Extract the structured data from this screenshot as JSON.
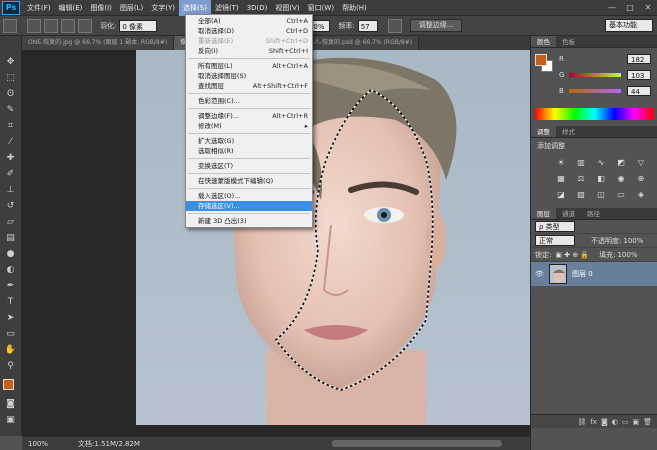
{
  "menubar": {
    "logo": "Ps",
    "items": [
      "文件(F)",
      "编辑(E)",
      "图像(I)",
      "图层(L)",
      "文字(Y)",
      "选择(S)",
      "滤镜(T)",
      "3D(D)",
      "视图(V)",
      "窗口(W)",
      "帮助(H)"
    ],
    "active_index": 5,
    "window_controls": [
      "—",
      "□",
      "✕"
    ]
  },
  "options": {
    "feather_label": "羽化:",
    "feather_value": "0 像素",
    "zoom_value": "0%",
    "frequency_label": "频率:",
    "frequency_value": "57",
    "refine_edge_button": "调整边缘...",
    "workspace": "基本功能"
  },
  "tabs": [
    {
      "label": "ONE-恢复的.jpg @ 66.7% (图层 1 副本, RGB/8#)",
      "active": false
    },
    {
      "label": "恢复的.jpg @ 66.7% (图层 0, RGB/8#) *",
      "active": true
    },
    {
      "label": "男人-恢复的.psd @ 66.7% (RGB/8#)",
      "active": false
    }
  ],
  "select_menu": {
    "groups": [
      [
        {
          "label": "全部(A)",
          "shortcut": "Ctrl+A",
          "disabled": false
        },
        {
          "label": "取消选择(D)",
          "shortcut": "Ctrl+D",
          "disabled": false
        },
        {
          "label": "重新选择(E)",
          "shortcut": "Shift+Ctrl+D",
          "disabled": true
        },
        {
          "label": "反向(I)",
          "shortcut": "Shift+Ctrl+I",
          "disabled": false
        }
      ],
      [
        {
          "label": "所有图层(L)",
          "shortcut": "Alt+Ctrl+A",
          "disabled": false
        },
        {
          "label": "取消选择图层(S)",
          "shortcut": "",
          "disabled": false
        },
        {
          "label": "查找图层",
          "shortcut": "Alt+Shift+Ctrl+F",
          "disabled": false
        }
      ],
      [
        {
          "label": "色彩范围(C)...",
          "shortcut": "",
          "disabled": false
        }
      ],
      [
        {
          "label": "调整边缘(F)...",
          "shortcut": "Alt+Ctrl+R",
          "disabled": false
        },
        {
          "label": "修改(M)",
          "shortcut": "▸",
          "disabled": false
        }
      ],
      [
        {
          "label": "扩大选取(G)",
          "shortcut": "",
          "disabled": false
        },
        {
          "label": "选取相似(R)",
          "shortcut": "",
          "disabled": false
        }
      ],
      [
        {
          "label": "变换选区(T)",
          "shortcut": "",
          "disabled": false
        }
      ],
      [
        {
          "label": "在快速蒙版模式下编辑(Q)",
          "shortcut": "",
          "disabled": false
        }
      ],
      [
        {
          "label": "载入选区(O)...",
          "shortcut": "",
          "disabled": false
        },
        {
          "label": "存储选区(V)...",
          "shortcut": "",
          "disabled": false,
          "highlighted": true
        }
      ],
      [
        {
          "label": "新建 3D 凸出(3)",
          "shortcut": "",
          "disabled": false
        }
      ]
    ]
  },
  "status": {
    "zoom": "100%",
    "doc_size": "文档:1.51M/2.82M"
  },
  "color_panel": {
    "tabs": [
      "颜色",
      "色板"
    ],
    "r_label": "R",
    "g_label": "G",
    "b_label": "B",
    "r": "182",
    "g": "103",
    "b": "44",
    "foreground": "#c75f18",
    "background": "#ffffff"
  },
  "adjust_panel": {
    "tabs": [
      "调整",
      "样式"
    ],
    "title": "添加调整"
  },
  "layers_panel": {
    "tabs": [
      "图层",
      "通道",
      "路径"
    ],
    "kind_filter": "ρ 类型",
    "blend_mode": "正常",
    "opacity_label": "不透明度:",
    "opacity": "100%",
    "lock_label": "锁定:",
    "fill_label": "填充:",
    "fill": "100%",
    "layers": [
      {
        "name": "图层 0",
        "visible": true
      }
    ]
  }
}
